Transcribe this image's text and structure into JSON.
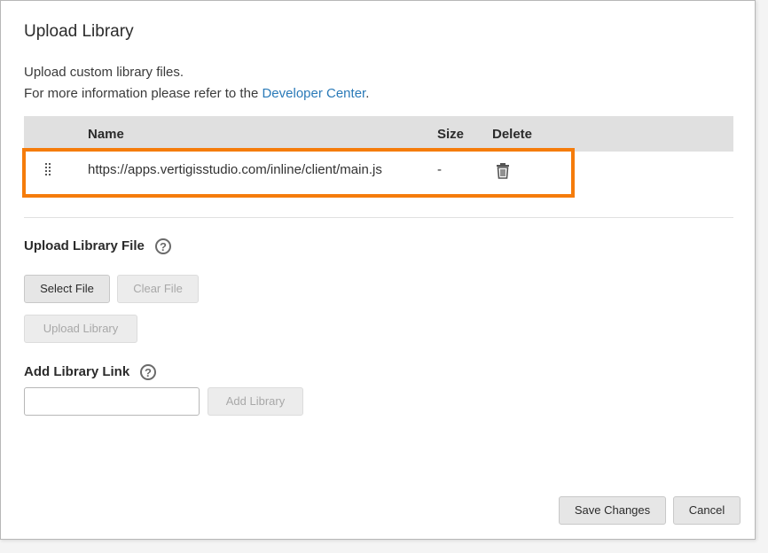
{
  "dialog": {
    "title": "Upload Library",
    "desc_line1": "Upload custom library files.",
    "desc_line2_prefix": "For more information please refer to the ",
    "desc_link": "Developer Center",
    "desc_line2_suffix": "."
  },
  "table": {
    "headers": {
      "name": "Name",
      "size": "Size",
      "delete": "Delete"
    },
    "rows": [
      {
        "name": "https://apps.vertigisstudio.com/inline/client/main.js",
        "size": "-"
      }
    ]
  },
  "upload_section": {
    "label": "Upload Library File",
    "select_file": "Select File",
    "clear_file": "Clear File",
    "upload_library": "Upload Library"
  },
  "link_section": {
    "label": "Add Library Link",
    "input_value": "",
    "add_library": "Add Library"
  },
  "footer": {
    "save": "Save Changes",
    "cancel": "Cancel"
  },
  "colors": {
    "highlight": "#f57c0b",
    "link": "#2a7ab8",
    "header_bg": "#e0e0e0"
  },
  "icons": {
    "drag": "drag-handle-icon",
    "delete": "trash-icon",
    "help": "help-icon"
  }
}
